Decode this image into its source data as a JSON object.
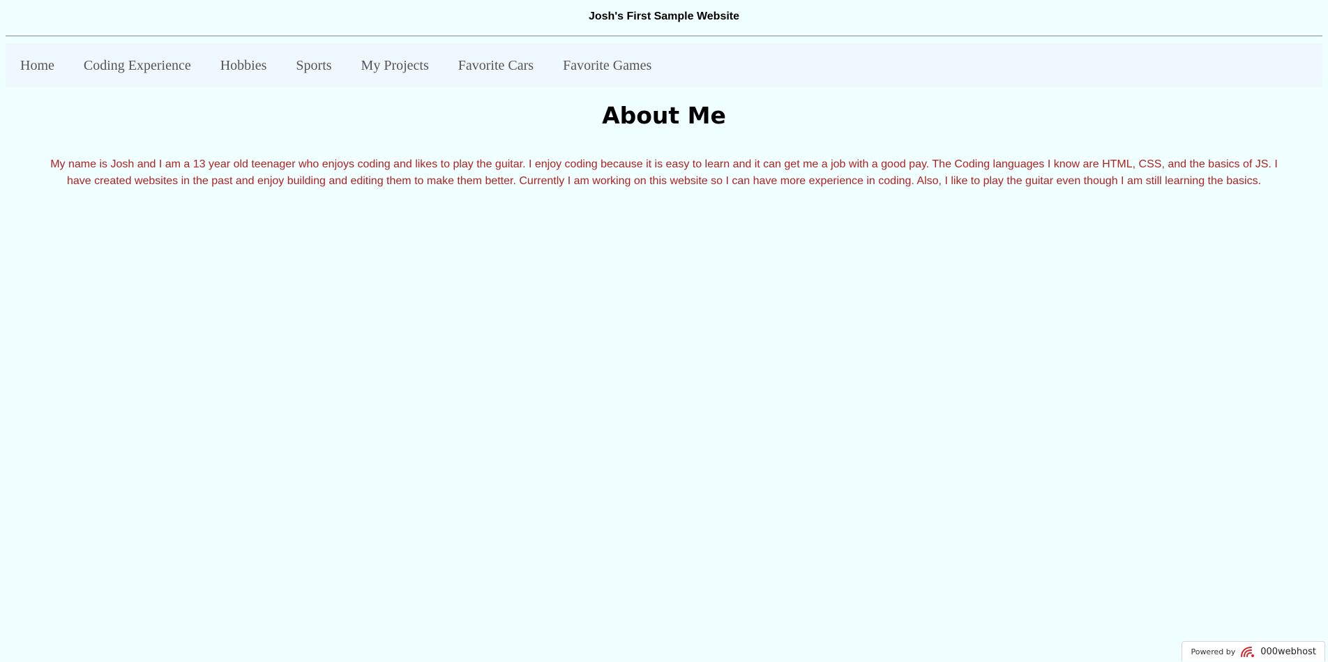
{
  "header": {
    "site_title": "Josh's First Sample Website"
  },
  "nav": {
    "items": [
      {
        "label": "Home"
      },
      {
        "label": "Coding Experience"
      },
      {
        "label": "Hobbies"
      },
      {
        "label": "Sports"
      },
      {
        "label": "My Projects"
      },
      {
        "label": "Favorite Cars"
      },
      {
        "label": "Favorite Games"
      }
    ]
  },
  "main": {
    "title": "About Me",
    "paragraph": "My name is Josh and I am a 13 year old teenager who enjoys coding and likes to play the guitar. I enjoy coding because it is easy to learn and it can get me a job with a good pay. The Coding languages I know are HTML, CSS, and the basics of JS. I have created websites in the past and enjoy building and editing them to make them better. Currently I am working on this website so I can have more experience in coding. Also, I like to play the guitar even though I am still learning the basics."
  },
  "badge": {
    "powered_by": "Powered by",
    "host_name": "000webhost",
    "icon": "000webhost-logo-icon"
  },
  "colors": {
    "background": "#f0ffff",
    "nav_background": "#f0f8ff",
    "nav_text": "#555555",
    "paragraph_text": "#b22222",
    "logo_red": "#d9252a"
  }
}
